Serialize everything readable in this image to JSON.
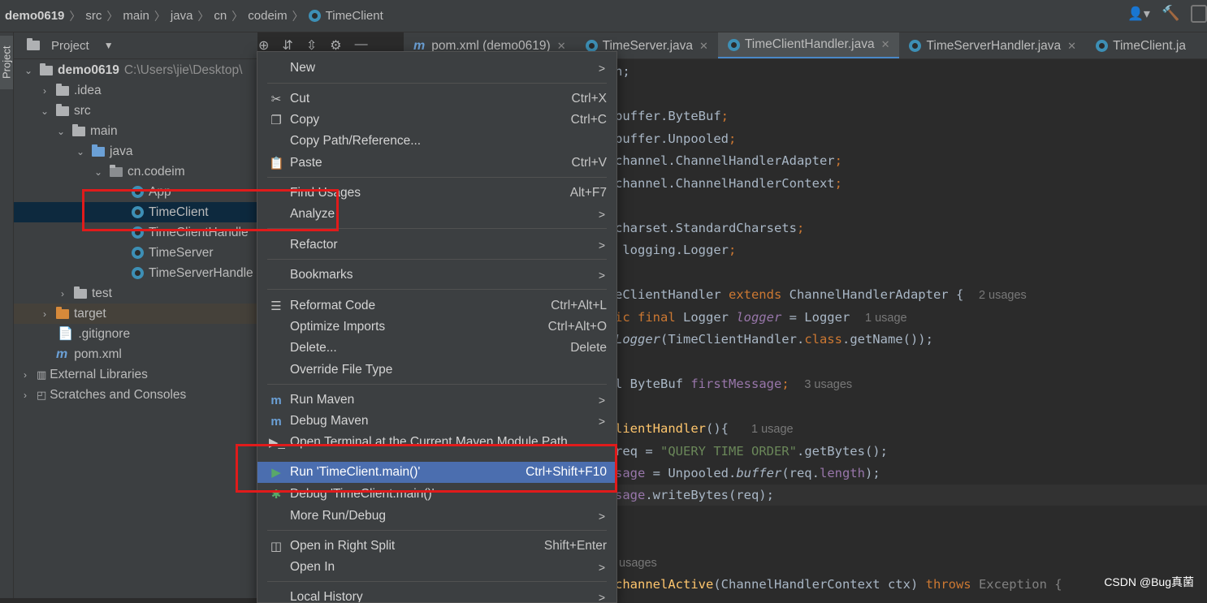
{
  "breadcrumb": [
    "demo0619",
    "src",
    "main",
    "java",
    "cn",
    "codeim",
    "TimeClient"
  ],
  "left_stripe_label": "Project",
  "project_panel": {
    "title": "Project",
    "root": {
      "name": "demo0619",
      "path": "C:\\Users\\jie\\Desktop\\"
    },
    "items": [
      {
        "label": ".idea"
      },
      {
        "label": "src"
      },
      {
        "label": "main"
      },
      {
        "label": "java"
      },
      {
        "label": "cn.codeim"
      },
      {
        "label": "App"
      },
      {
        "label": "TimeClient"
      },
      {
        "label": "TimeClientHandle"
      },
      {
        "label": "TimeServer"
      },
      {
        "label": "TimeServerHandle"
      },
      {
        "label": "test"
      },
      {
        "label": "target"
      },
      {
        "label": ".gitignore"
      },
      {
        "label": "pom.xml"
      },
      {
        "label": "External Libraries"
      },
      {
        "label": "Scratches and Consoles"
      }
    ]
  },
  "tabs": [
    {
      "label": "pom.xml (demo0619)"
    },
    {
      "label": "TimeServer.java"
    },
    {
      "label": "TimeClientHandler.java"
    },
    {
      "label": "TimeServerHandler.java"
    },
    {
      "label": "TimeClient.ja"
    }
  ],
  "code": {
    "l1": "n;",
    "l2a": "buffer.ByteBuf",
    "l3a": "buffer.Unpooled",
    "l4a": "channel.ChannelHandlerAdapter",
    "l5a": "channel.ChannelHandlerContext",
    "l6a": "charset.StandardCharsets",
    "l7a": " logging.Logger",
    "semi": ";",
    "l8a": "eClientHandler ",
    "l8b": "extends",
    "l8c": " ChannelHandlerAdapter {",
    "l8h": "2 usages",
    "l9a": "ic final",
    "l9b": " Logger ",
    "l9c": "logger",
    "l9d": " = Logger",
    "l9h": "1 usage",
    "l10a": "Logger",
    "l10b": "(TimeClientHandler.",
    "l10c": "class",
    "l10d": ".getName());",
    "l11a": "l ByteBuf ",
    "l11b": "firstMessage",
    "l11c": ";",
    "l11h": "3 usages",
    "l12a": "lientHandler",
    "l12b": "(){",
    "l12h": "1 usage",
    "l13a": "req = ",
    "l13b": "\"QUERY TIME ORDER\"",
    "l13c": ".getBytes();",
    "l14a": "sage",
    "l14b": " = Unpooled.",
    "l14c": "buffer",
    "l14d": "(req.",
    "l14e": "length",
    "l14f": ");",
    "l15a": "sage",
    "l15b": ".writeBytes(req);",
    "l16h": "usages",
    "l17a": "channelActive",
    "l17b": "(ChannelHandlerContext ctx) ",
    "l17c": "throws",
    "l17d": " Exception {"
  },
  "context_menu": [
    {
      "label": "New",
      "shortcut": "",
      "submenu": true
    },
    {
      "label": "Cut",
      "shortcut": "Ctrl+X",
      "icon": "scissors-icon"
    },
    {
      "label": "Copy",
      "shortcut": "Ctrl+C",
      "icon": "copy-icon"
    },
    {
      "label": "Copy Path/Reference...",
      "shortcut": ""
    },
    {
      "label": "Paste",
      "shortcut": "Ctrl+V",
      "icon": "paste-icon"
    },
    {
      "label": "Find Usages",
      "shortcut": "Alt+F7"
    },
    {
      "label": "Analyze",
      "shortcut": "",
      "submenu": true
    },
    {
      "label": "Refactor",
      "shortcut": "",
      "submenu": true
    },
    {
      "label": "Bookmarks",
      "shortcut": "",
      "submenu": true
    },
    {
      "label": "Reformat Code",
      "shortcut": "Ctrl+Alt+L",
      "icon": "reformat-icon"
    },
    {
      "label": "Optimize Imports",
      "shortcut": "Ctrl+Alt+O"
    },
    {
      "label": "Delete...",
      "shortcut": "Delete"
    },
    {
      "label": "Override File Type",
      "shortcut": ""
    },
    {
      "label": "Run Maven",
      "shortcut": "",
      "submenu": true,
      "icon": "maven-run-icon"
    },
    {
      "label": "Debug Maven",
      "shortcut": "",
      "submenu": true,
      "icon": "maven-debug-icon"
    },
    {
      "label": "Open Terminal at the Current Maven Module Path",
      "shortcut": "",
      "icon": "terminal-icon"
    },
    {
      "label": "Run 'TimeClient.main()'",
      "shortcut": "Ctrl+Shift+F10",
      "icon": "run-icon",
      "highlighted": true
    },
    {
      "label": "Debug 'TimeClient.main()'",
      "shortcut": "",
      "icon": "debug-icon"
    },
    {
      "label": "More Run/Debug",
      "shortcut": "",
      "submenu": true
    },
    {
      "label": "Open in Right Split",
      "shortcut": "Shift+Enter",
      "icon": "split-icon"
    },
    {
      "label": "Open In",
      "shortcut": "",
      "submenu": true
    },
    {
      "label": "Local History",
      "shortcut": "",
      "submenu": true
    }
  ],
  "colors": {
    "highlight": "#4b6eaf",
    "selection": "#0d293e",
    "annotation_red": "#e01b1b",
    "keyword": "#cc7832",
    "string": "#6a8759",
    "field": "#9876aa"
  },
  "watermark": "CSDN @Bug真菌"
}
